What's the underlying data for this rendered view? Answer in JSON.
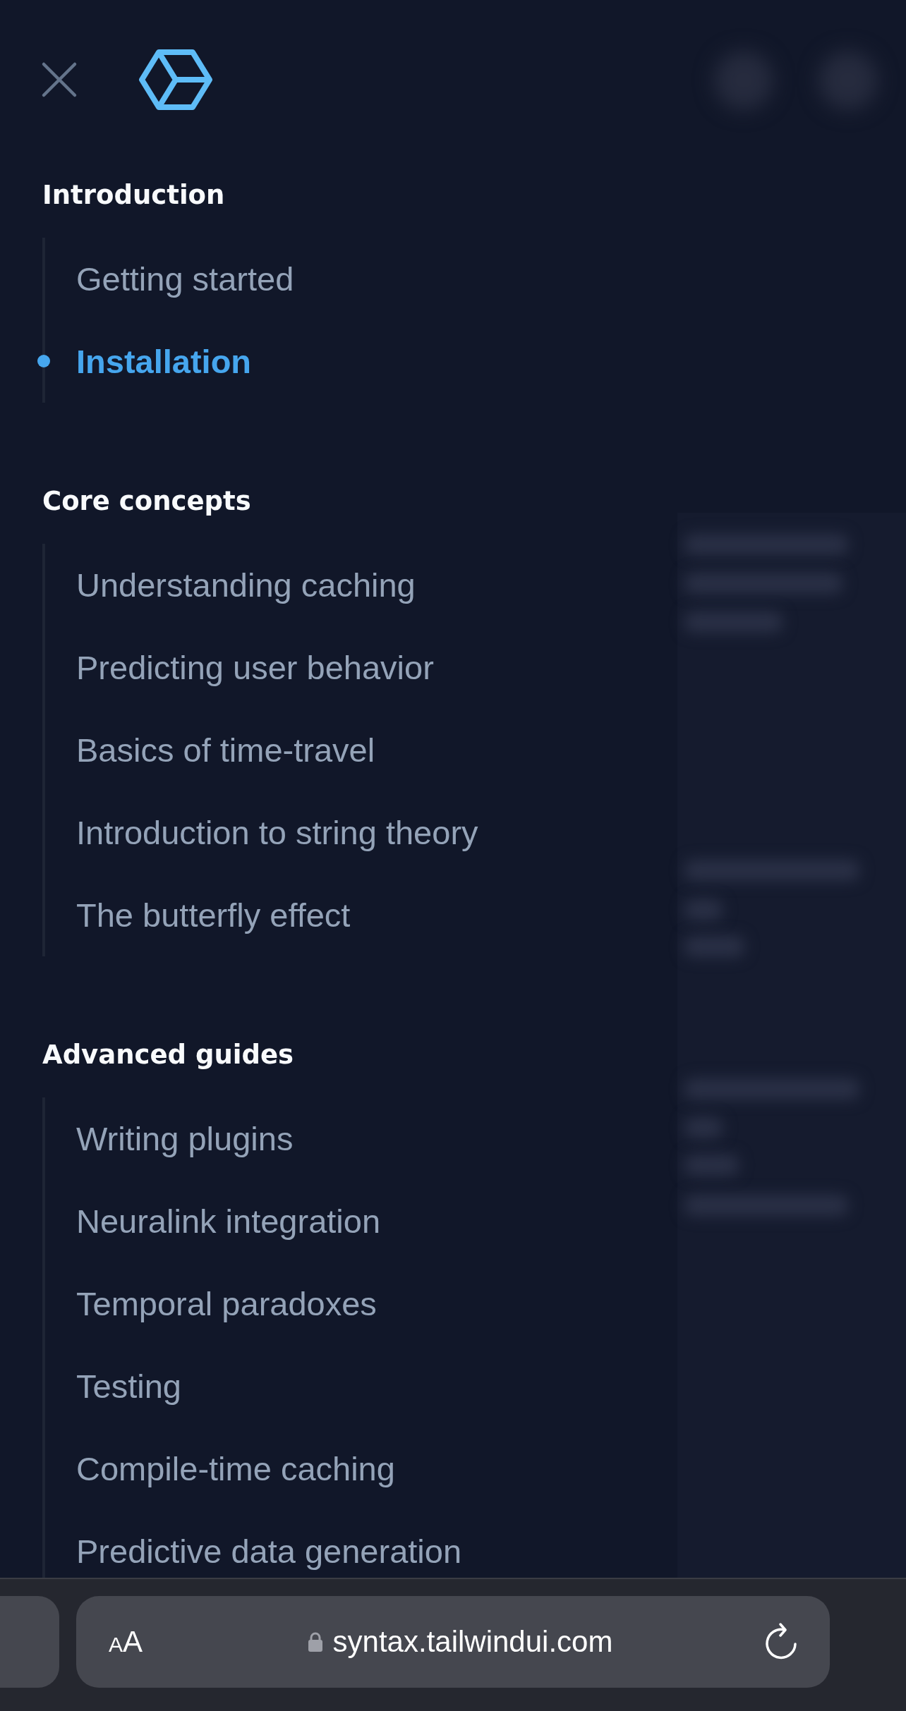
{
  "nav": {
    "sections": [
      {
        "title": "Introduction",
        "items": [
          {
            "label": "Getting started",
            "selected": false
          },
          {
            "label": "Installation",
            "selected": true
          }
        ]
      },
      {
        "title": "Core concepts",
        "items": [
          {
            "label": "Understanding caching",
            "selected": false
          },
          {
            "label": "Predicting user behavior",
            "selected": false
          },
          {
            "label": "Basics of time-travel",
            "selected": false
          },
          {
            "label": "Introduction to string theory",
            "selected": false
          },
          {
            "label": "The butterfly effect",
            "selected": false
          }
        ]
      },
      {
        "title": "Advanced guides",
        "items": [
          {
            "label": "Writing plugins",
            "selected": false
          },
          {
            "label": "Neuralink integration",
            "selected": false
          },
          {
            "label": "Temporal paradoxes",
            "selected": false
          },
          {
            "label": "Testing",
            "selected": false
          },
          {
            "label": "Compile-time caching",
            "selected": false
          },
          {
            "label": "Predictive data generation",
            "selected": false
          }
        ]
      }
    ]
  },
  "browser_bar": {
    "text_size_button": "AA",
    "url": "syntax.tailwindui.com"
  }
}
